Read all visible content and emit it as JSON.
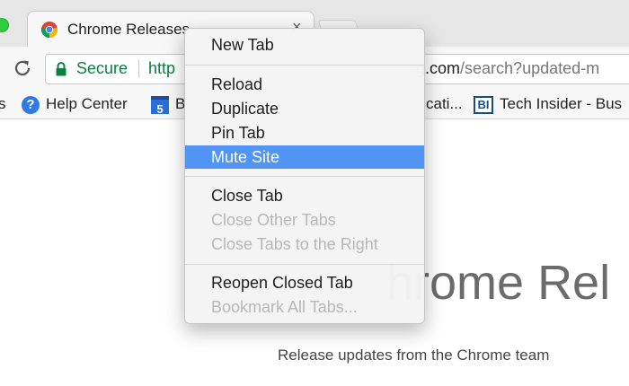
{
  "tab": {
    "title": "Chrome Releases",
    "close_glyph": "×"
  },
  "omnibox": {
    "secure_label": "Secure",
    "url_prefix": "http",
    "url_host_tail": "g.com",
    "url_path": "/search?updated-m"
  },
  "bookmarks": {
    "left_fragment": "s",
    "help_center": "Help Center",
    "b_fragment": "B",
    "cati_fragment": "cati...",
    "tech_insider": "Tech Insider - Bus",
    "cal_icon_text": "5",
    "bi_icon_text": "BI"
  },
  "context_menu": {
    "items": [
      {
        "label": "New Tab",
        "enabled": true
      },
      {
        "label": "Reload",
        "enabled": true
      },
      {
        "label": "Duplicate",
        "enabled": true
      },
      {
        "label": "Pin Tab",
        "enabled": true
      },
      {
        "label": "Mute Site",
        "enabled": true,
        "highlighted": true
      },
      {
        "label": "Close Tab",
        "enabled": true
      },
      {
        "label": "Close Other Tabs",
        "enabled": false
      },
      {
        "label": "Close Tabs to the Right",
        "enabled": false
      },
      {
        "label": "Reopen Closed Tab",
        "enabled": true
      },
      {
        "label": "Bookmark All Tabs...",
        "enabled": false
      }
    ]
  },
  "page": {
    "heading_fragment": "hrome Rel",
    "subtitle": "Release updates from the Chrome team"
  },
  "colors": {
    "highlight": "#5194f4",
    "secure": "#0b8043"
  }
}
